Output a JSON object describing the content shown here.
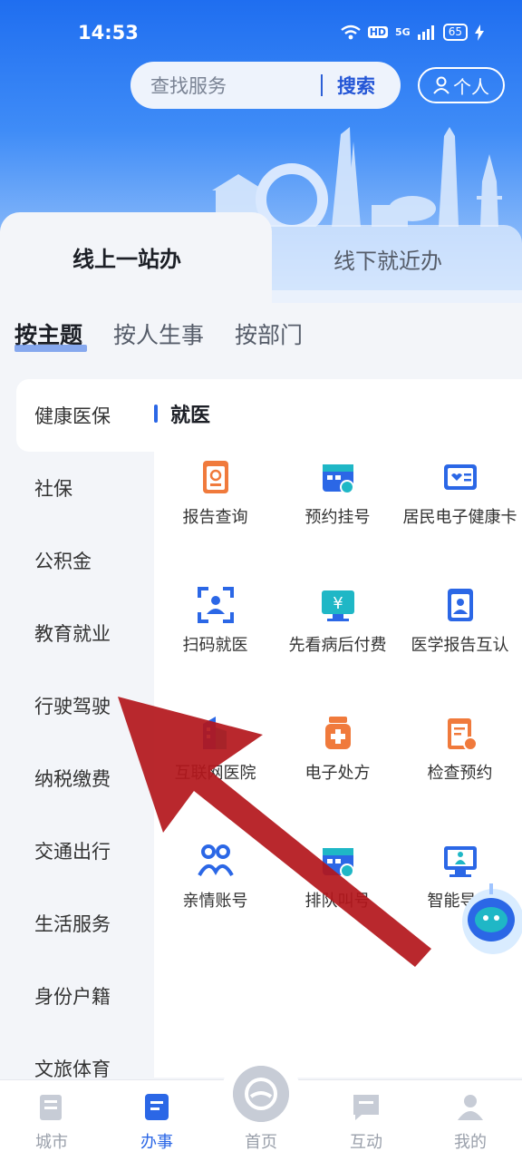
{
  "status": {
    "time": "14:53",
    "network": "5G",
    "battery": "65",
    "hd": "HD"
  },
  "header": {
    "search_placeholder": "查找服务",
    "search_button": "搜索",
    "personal_label": "个人"
  },
  "main_tabs": [
    {
      "label": "线上一站办"
    },
    {
      "label": "线下就近办"
    }
  ],
  "sub_tabs": [
    {
      "label": "按主题"
    },
    {
      "label": "按人生事"
    },
    {
      "label": "按部门"
    }
  ],
  "sidebar": {
    "items": [
      {
        "label": "健康医保"
      },
      {
        "label": "社保"
      },
      {
        "label": "公积金"
      },
      {
        "label": "教育就业"
      },
      {
        "label": "行驶驾驶"
      },
      {
        "label": "纳税缴费"
      },
      {
        "label": "交通出行"
      },
      {
        "label": "生活服务"
      },
      {
        "label": "身份户籍"
      },
      {
        "label": "文旅体育"
      }
    ]
  },
  "panel": {
    "category": "就医",
    "services": [
      {
        "label": "报告查询",
        "icon": "report-icon"
      },
      {
        "label": "预约挂号",
        "icon": "calendar-appointment-icon"
      },
      {
        "label": "居民电子健康卡",
        "icon": "health-card-icon"
      },
      {
        "label": "扫码就医",
        "icon": "scan-icon"
      },
      {
        "label": "先看病后付费",
        "icon": "payment-monitor-icon"
      },
      {
        "label": "医学报告互认",
        "icon": "medical-report-icon"
      },
      {
        "label": "互联网医院",
        "icon": "hospital-building-icon"
      },
      {
        "label": "电子处方",
        "icon": "prescription-bottle-icon"
      },
      {
        "label": "检查预约",
        "icon": "checkup-clipboard-icon"
      },
      {
        "label": "亲情账号",
        "icon": "family-account-icon"
      },
      {
        "label": "排队叫号",
        "icon": "queue-calendar-icon"
      },
      {
        "label": "智能导诊",
        "icon": "smart-guide-icon"
      }
    ]
  },
  "bottom_nav": [
    {
      "label": "城市",
      "icon": "city-icon"
    },
    {
      "label": "办事",
      "icon": "tasks-icon"
    },
    {
      "label": "首页",
      "icon": "home-icon"
    },
    {
      "label": "互动",
      "icon": "chat-icon"
    },
    {
      "label": "我的",
      "icon": "profile-icon"
    }
  ],
  "colors": {
    "primary": "#2b67e6",
    "orange": "#f07a3c",
    "annotation_arrow": "#b3161b"
  }
}
